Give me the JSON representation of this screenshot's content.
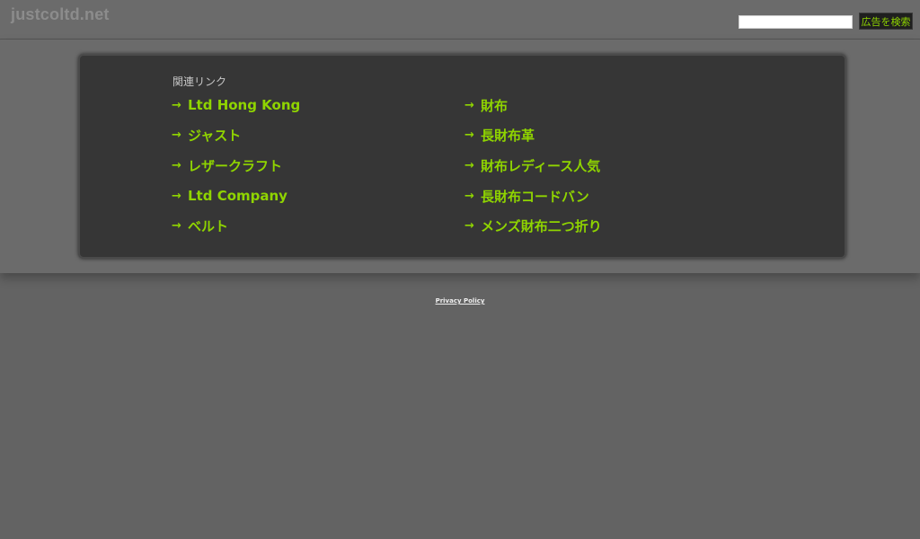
{
  "header": {
    "site_name": "justcoltd.net",
    "search": {
      "value": "",
      "placeholder": "",
      "button_label": "広告を検索"
    }
  },
  "related": {
    "title": "関連リンク",
    "arrow_icon": "→",
    "left": [
      "Ltd Hong Kong",
      "ジャスト",
      "レザークラフト",
      "Ltd Company",
      "ベルト"
    ],
    "right": [
      "財布",
      "長財布革",
      "財布レディース人気",
      "長財布コードバン",
      "メンズ財布二つ折り"
    ]
  },
  "footer": {
    "privacy_policy": "Privacy Policy"
  },
  "colors": {
    "background": "#636363",
    "band": "#6b6b6b",
    "panel": "#363636",
    "link_green": "#8fd400"
  }
}
